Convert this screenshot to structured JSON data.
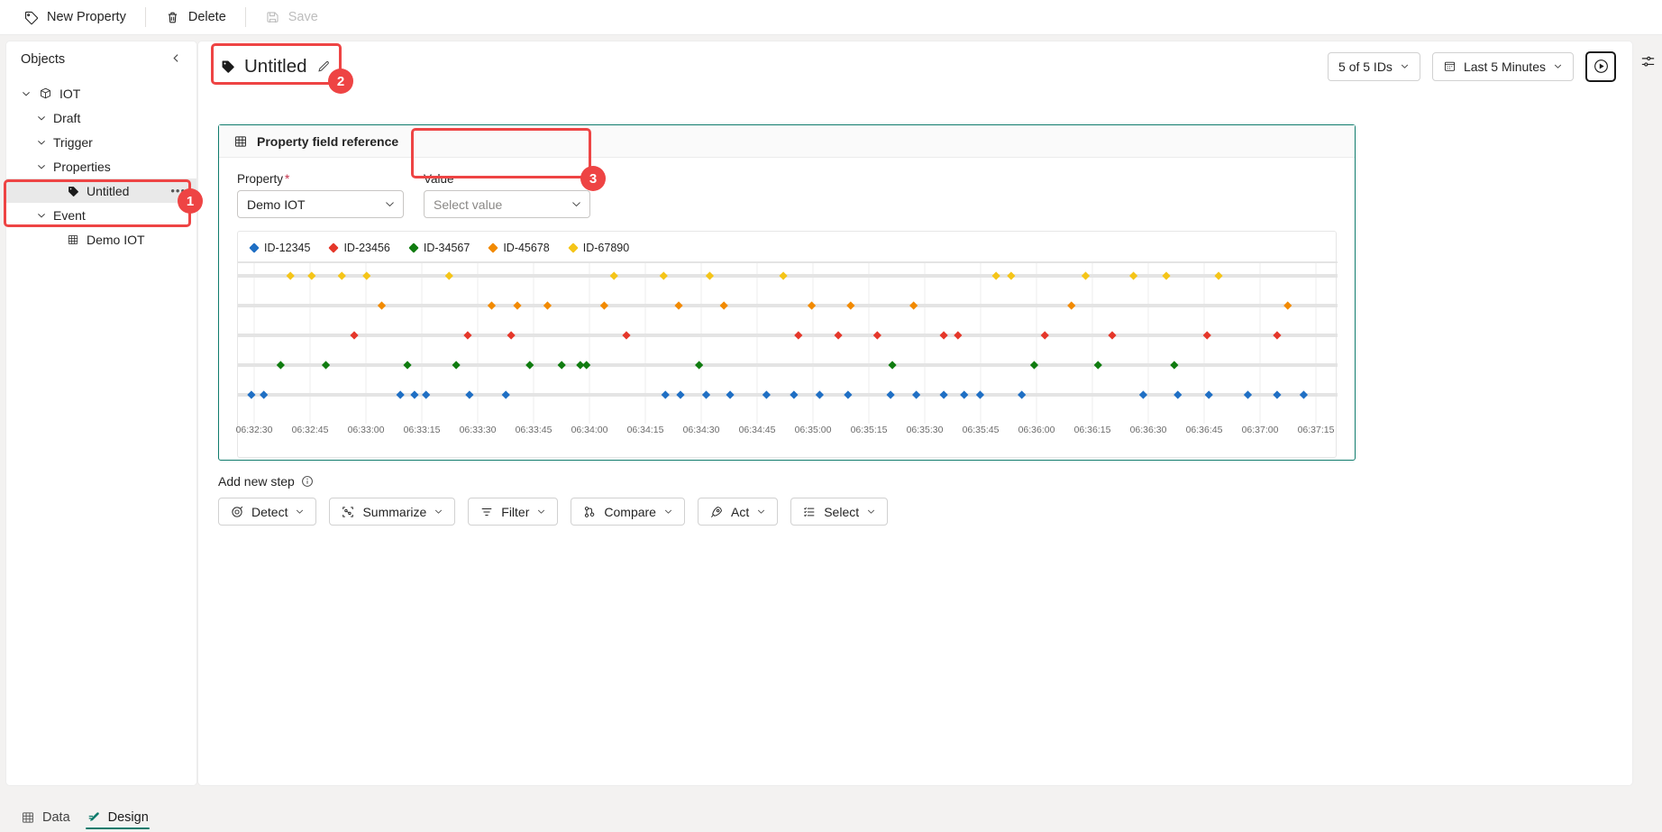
{
  "commandbar": {
    "items": [
      {
        "label": "New Property",
        "icon": "tag-icon",
        "disabled": false
      },
      {
        "label": "Delete",
        "icon": "trash-icon",
        "disabled": false
      },
      {
        "label": "Save",
        "icon": "save-icon",
        "disabled": true
      }
    ]
  },
  "sidebar": {
    "title": "Objects",
    "collapse_icon": "chevron-left-icon",
    "tree": [
      {
        "label": "IOT",
        "indent": 0,
        "chevron": "chevron-down-icon",
        "icon": "cube-icon",
        "selected": false,
        "dots": false
      },
      {
        "label": "Draft",
        "indent": 1,
        "chevron": "chevron-down-icon",
        "icon": "",
        "selected": false,
        "dots": false
      },
      {
        "label": "Trigger",
        "indent": 1,
        "chevron": "chevron-down-icon",
        "icon": "",
        "selected": false,
        "dots": false
      },
      {
        "label": "Properties",
        "indent": 1,
        "chevron": "chevron-down-icon",
        "icon": "",
        "selected": false,
        "dots": false
      },
      {
        "label": "Untitled",
        "indent": 3,
        "chevron": "",
        "icon": "tag-icon",
        "selected": true,
        "dots": true
      },
      {
        "label": "Event",
        "indent": 1,
        "chevron": "chevron-down-icon",
        "icon": "",
        "selected": false,
        "dots": false
      },
      {
        "label": "Demo IOT",
        "indent": 3,
        "chevron": "",
        "icon": "table-icon",
        "selected": false,
        "dots": false
      }
    ]
  },
  "header": {
    "title": "Untitled",
    "title_icon": "tag-icon",
    "edit_icon": "pencil-icon",
    "ids_filter": "5 of 5 IDs",
    "time_range": "Last 5 Minutes",
    "time_icon": "calendar-icon",
    "play_icon": "play-circle-icon",
    "settings_icon": "sliders-icon"
  },
  "card": {
    "title": "Property field reference",
    "title_icon": "table-icon",
    "border_color": "#0f7b6c",
    "property_field": {
      "label": "Property",
      "required_mark": "*",
      "value": "Demo IOT",
      "chevron": "chevron-down-icon"
    },
    "value_field": {
      "label": "Value",
      "placeholder": "Select value",
      "chevron": "chevron-down-icon"
    }
  },
  "add_step": {
    "label": "Add new step",
    "info_icon": "info-icon",
    "buttons": [
      {
        "label": "Detect",
        "icon": "target-icon"
      },
      {
        "label": "Summarize",
        "icon": "summarize-icon"
      },
      {
        "label": "Filter",
        "icon": "filter-icon"
      },
      {
        "label": "Compare",
        "icon": "compare-icon"
      },
      {
        "label": "Act",
        "icon": "rocket-icon"
      },
      {
        "label": "Select",
        "icon": "select-list-icon"
      }
    ]
  },
  "bottom_tabs": [
    {
      "label": "Data",
      "icon": "table-icon",
      "active": false
    },
    {
      "label": "Design",
      "icon": "pen-icon",
      "active": true
    }
  ],
  "annotations": [
    {
      "number": "1",
      "target": "sidebar-properties-group"
    },
    {
      "number": "2",
      "target": "page-title"
    },
    {
      "number": "3",
      "target": "value-field"
    }
  ],
  "chart_data": {
    "type": "scatter",
    "title": "",
    "xlabel": "",
    "ylabel": "",
    "grid": true,
    "legend_position": "top-left",
    "marker": "diamond",
    "x_tick_labels": [
      "06:32:30",
      "06:32:45",
      "06:33:00",
      "06:33:15",
      "06:33:30",
      "06:33:45",
      "06:34:00",
      "06:34:15",
      "06:34:30",
      "06:34:45",
      "06:35:00",
      "06:35:15",
      "06:35:30",
      "06:35:45",
      "06:36:00",
      "06:36:15",
      "06:36:30",
      "06:36:45",
      "06:37:00",
      "06:37:15"
    ],
    "x_range_seconds": [
      0,
      300
    ],
    "lanes": [
      "ID-67890",
      "ID-45678",
      "ID-23456",
      "ID-34567",
      "ID-12345"
    ],
    "series": [
      {
        "name": "ID-12345",
        "color": "#1f6fc4",
        "lane": 4,
        "x": [
          5,
          19,
          173,
          189,
          202,
          251,
          292,
          472,
          489,
          518,
          545,
          586,
          617,
          646,
          678,
          726,
          755,
          786,
          809,
          827,
          874,
          1011,
          1050,
          1085,
          1129,
          1162,
          1192
        ]
      },
      {
        "name": "ID-23456",
        "color": "#e5372a",
        "lane": 2,
        "x": [
          121,
          249,
          298,
          428,
          622,
          667,
          711,
          786,
          802,
          900,
          976,
          1083,
          1162
        ]
      },
      {
        "name": "ID-34567",
        "color": "#107c10",
        "lane": 3,
        "x": [
          38,
          89,
          181,
          236,
          319,
          355,
          376,
          383,
          510,
          728,
          888,
          960,
          1046
        ]
      },
      {
        "name": "ID-45678",
        "color": "#f28a00",
        "lane": 1,
        "x": [
          152,
          276,
          305,
          339,
          403,
          487,
          538,
          637,
          681,
          752,
          930,
          1174
        ]
      },
      {
        "name": "ID-67890",
        "color": "#f5c518",
        "lane": 0,
        "x": [
          49,
          73,
          107,
          135,
          228,
          414,
          470,
          522,
          605,
          845,
          862,
          946,
          1000,
          1037,
          1096
        ]
      }
    ]
  }
}
